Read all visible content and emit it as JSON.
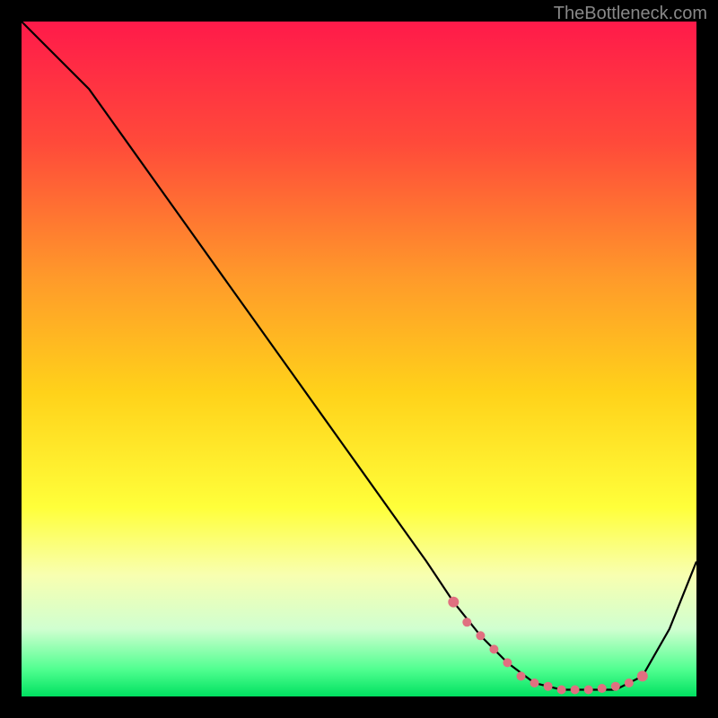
{
  "attribution": "TheBottleneck.com",
  "chart_data": {
    "type": "line",
    "title": "",
    "xlabel": "",
    "ylabel": "",
    "xlim": [
      0,
      100
    ],
    "ylim": [
      0,
      100
    ],
    "gradient_stops": [
      {
        "offset": 0,
        "color": "#ff1a4a"
      },
      {
        "offset": 18,
        "color": "#ff4a3a"
      },
      {
        "offset": 38,
        "color": "#ff9a2a"
      },
      {
        "offset": 55,
        "color": "#ffd21a"
      },
      {
        "offset": 72,
        "color": "#ffff3a"
      },
      {
        "offset": 82,
        "color": "#f8ffb0"
      },
      {
        "offset": 90,
        "color": "#d0ffd0"
      },
      {
        "offset": 96,
        "color": "#50ff90"
      },
      {
        "offset": 100,
        "color": "#00e060"
      }
    ],
    "series": [
      {
        "name": "bottleneck-curve",
        "x": [
          0,
          3,
          6,
          10,
          15,
          20,
          25,
          30,
          35,
          40,
          45,
          50,
          55,
          60,
          64,
          68,
          72,
          76,
          80,
          84,
          88,
          92,
          96,
          100
        ],
        "y": [
          100,
          97,
          94,
          90,
          83,
          76,
          69,
          62,
          55,
          48,
          41,
          34,
          27,
          20,
          14,
          9,
          5,
          2,
          1,
          1,
          1,
          3,
          10,
          20
        ]
      }
    ],
    "marker_series": {
      "name": "highlight-dots",
      "x": [
        64,
        66,
        68,
        70,
        72,
        74,
        76,
        78,
        80,
        82,
        84,
        86,
        88,
        90,
        92
      ],
      "y": [
        14,
        11,
        9,
        7,
        5,
        3,
        2,
        1.5,
        1,
        1,
        1,
        1.2,
        1.5,
        2,
        3
      ]
    },
    "marker_color": "#e07080"
  }
}
